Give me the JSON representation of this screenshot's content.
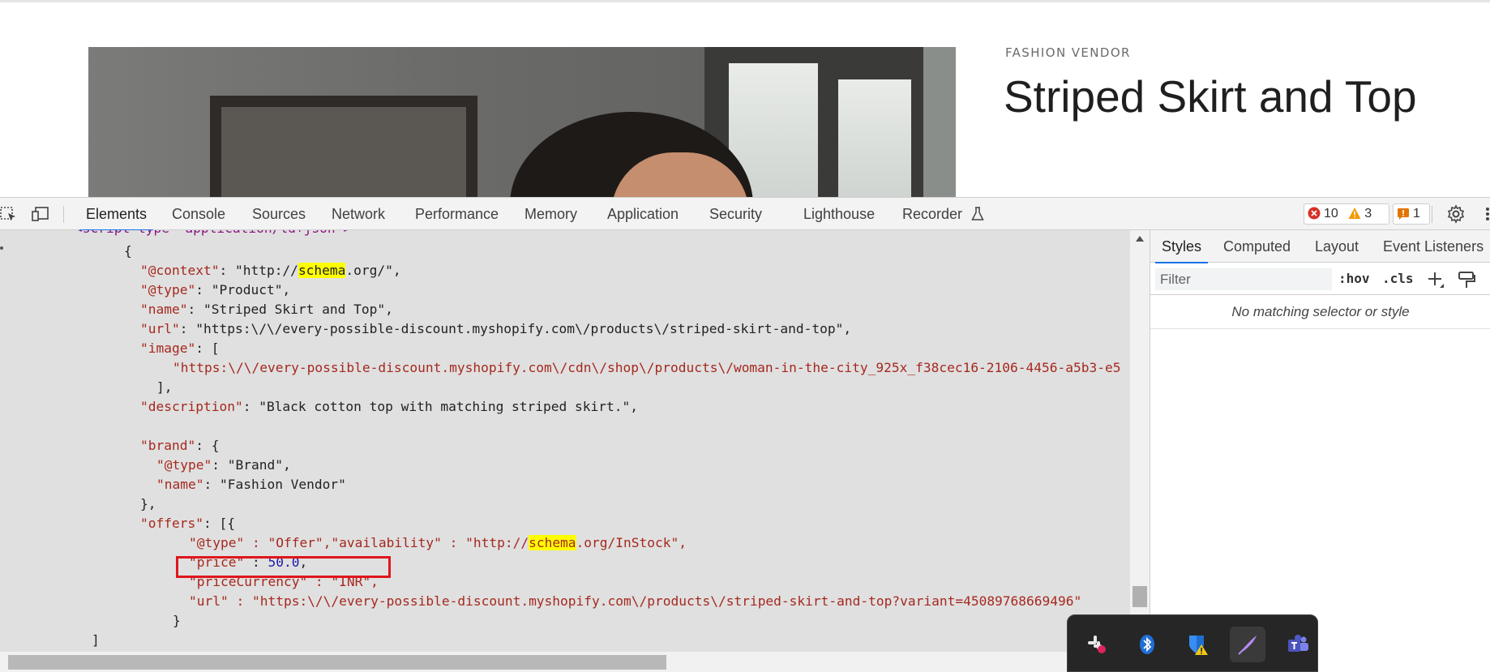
{
  "page": {
    "vendor": "FASHION VENDOR",
    "title": "Striped Skirt and Top"
  },
  "devtools": {
    "tabs": [
      "Elements",
      "Console",
      "Sources",
      "Network",
      "Performance",
      "Memory",
      "Application",
      "Security",
      "Lighthouse",
      "Recorder"
    ],
    "active_tab": "Elements",
    "counts": {
      "errors": "10",
      "warnings": "3",
      "issues": "1"
    },
    "code_lines": {
      "l0": "<script type=\"application/ld+json\">",
      "l1": "{",
      "l2_key": "\"@context\"",
      "l2_pre": ": \"http://",
      "l2_hl": "schema",
      "l2_post": ".org/\",",
      "l3_key": "\"@type\"",
      "l3_val": ": \"Product\",",
      "l4_key": "\"name\"",
      "l4_val": ": \"Striped Skirt and Top\",",
      "l5_key": "\"url\"",
      "l5_val": ": \"https:\\/\\/every-possible-discount.myshopify.com\\/products\\/striped-skirt-and-top\",",
      "l6_key": "\"image\"",
      "l6_val": ": [",
      "l7": "\"https:\\/\\/every-possible-discount.myshopify.com\\/cdn\\/shop\\/products\\/woman-in-the-city_925x_f38cec16-2106-4456-a5b3-e5",
      "l8": "],",
      "l9_key": "\"description\"",
      "l9_val": ": \"Black cotton top with matching striped skirt.\",",
      "l11_key": "\"brand\"",
      "l11_val": ": {",
      "l12_key": "\"@type\"",
      "l12_val": ": \"Brand\",",
      "l13_key": "\"name\"",
      "l13_val": ": \"Fashion Vendor\"",
      "l14": "},",
      "l15_key": "\"offers\"",
      "l15_val": ": [{",
      "l16_a": "\"@type\" : \"Offer\",\"availability\" : \"http://",
      "l16_hl": "schema",
      "l16_b": ".org/InStock\",",
      "l17_key": "\"price\"",
      "l17_sep": " : ",
      "l17_num": "50.0",
      "l17_end": ",",
      "l18": "\"priceCurrency\" : \"INR\",",
      "l19": "\"url\" : \"https:\\/\\/every-possible-discount.myshopify.com\\/products\\/striped-skirt-and-top?variant=45089768669496\"",
      "l20": "}",
      "l21": "]"
    },
    "sidebar": {
      "tabs": [
        "Styles",
        "Computed",
        "Layout",
        "Event Listeners"
      ],
      "active_tab": "Styles",
      "filter_placeholder": "Filter",
      "hov": ":hov",
      "cls": ".cls",
      "empty_message": "No matching selector or style"
    }
  },
  "tray_icons": [
    "slack-icon",
    "bluetooth-icon",
    "security-warning-icon",
    "pen-icon",
    "teams-icon"
  ],
  "colors": {
    "accent": "#1a73e8",
    "error": "#d93025",
    "warning": "#f29900",
    "highlight": "#ffff00",
    "annotation": "#e0161c"
  }
}
